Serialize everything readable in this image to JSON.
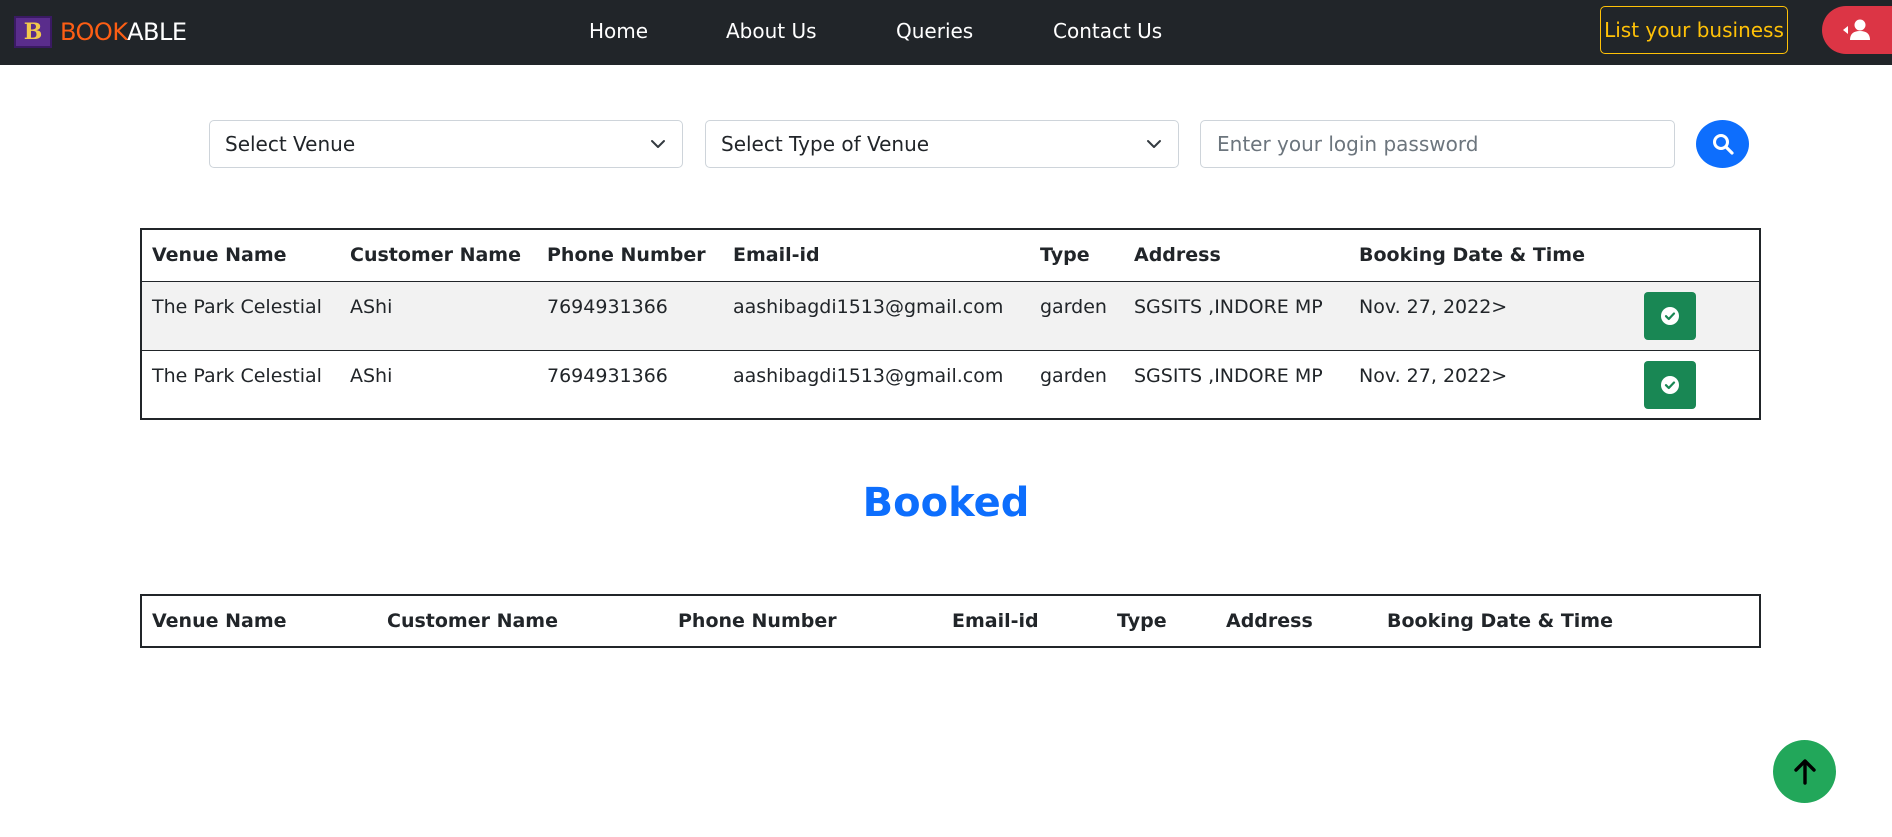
{
  "brand": {
    "logo_letter": "B",
    "name_part1": "BOOK",
    "name_part2": "ABLE"
  },
  "nav": {
    "home": "Home",
    "about": "About Us",
    "queries": "Queries",
    "contact": "Contact Us"
  },
  "header_actions": {
    "list_business": "List your business",
    "user_icon": "user-icon"
  },
  "search": {
    "venue_select": "Select Venue",
    "type_select": "Select Type of Venue",
    "password_placeholder": "Enter your login password",
    "search_icon": "search-icon"
  },
  "pending_table": {
    "columns": [
      "Venue Name",
      "Customer Name",
      "Phone Number",
      "Email-id",
      "Type",
      "Address",
      "Booking Date & Time"
    ],
    "rows": [
      {
        "venue": "The Park Celestial",
        "customer": "AShi",
        "phone": "7694931366",
        "email": "aashibagdi1513@gmail.com",
        "type": "garden",
        "address": "SGSITS ,INDORE MP",
        "datetime": "Nov. 27, 2022>"
      },
      {
        "venue": "The Park Celestial",
        "customer": "AShi",
        "phone": "7694931366",
        "email": "aashibagdi1513@gmail.com",
        "type": "garden",
        "address": "SGSITS ,INDORE MP",
        "datetime": "Nov. 27, 2022>"
      }
    ]
  },
  "booked_section": {
    "title": "Booked"
  },
  "booked_table": {
    "columns": [
      "Venue Name",
      "Customer Name",
      "Phone Number",
      "Email-id",
      "Type",
      "Address",
      "Booking Date & Time"
    ]
  },
  "colors": {
    "navbar": "#212529",
    "brand_accent": "#fd5e14",
    "warning": "#ffc107",
    "danger": "#dc3545",
    "primary": "#0d6efd",
    "success": "#198754",
    "scroll_top": "#22a75a"
  },
  "icons": {
    "confirm": "check-circle-icon",
    "scroll_top": "arrow-up-icon"
  }
}
